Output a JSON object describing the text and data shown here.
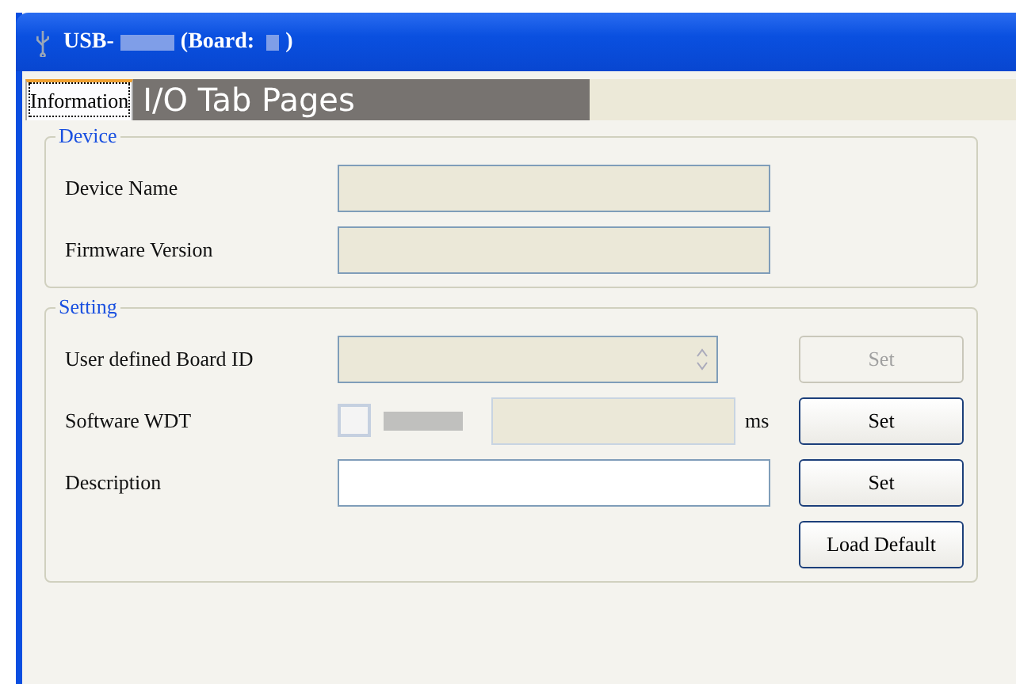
{
  "window": {
    "title_parts": [
      {
        "kind": "text",
        "text": "USB-"
      },
      {
        "kind": "blur"
      },
      {
        "kind": "text",
        "text": "(Board: "
      },
      {
        "kind": "blur"
      },
      {
        "kind": "text",
        "text": ")"
      }
    ]
  },
  "tabs": [
    {
      "label": "Information",
      "selected": true
    }
  ],
  "overlay_label": "I/O Tab Pages",
  "groups": [
    {
      "legend": "Device",
      "rows": [
        {
          "label": "Device Name",
          "kind": "text",
          "disabled": true
        },
        {
          "label": "Firmware Version",
          "kind": "text",
          "disabled": true
        }
      ]
    },
    {
      "legend": "Setting",
      "rows": [
        {
          "label": "User defined Board ID",
          "kind": "spin",
          "disabled": true,
          "button": {
            "label": "Set",
            "disabled": true
          }
        },
        {
          "label": "Software WDT",
          "kind": "wdt",
          "checked": false,
          "unit": "ms",
          "button": {
            "label": "Set",
            "disabled": false
          }
        },
        {
          "label": "Description",
          "kind": "text",
          "disabled": false,
          "button": {
            "label": "Set",
            "disabled": false
          }
        },
        {
          "kind": "button-only",
          "button": {
            "label": "Load Default",
            "disabled": false
          }
        }
      ]
    }
  ]
}
